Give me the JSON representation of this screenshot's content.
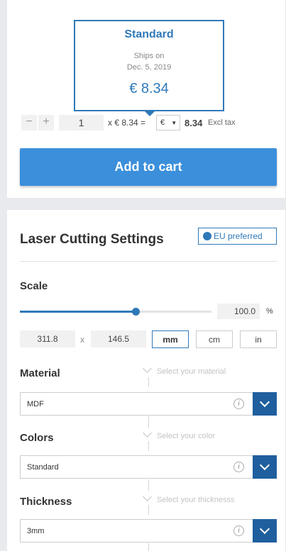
{
  "shipping": {
    "title": "Standard",
    "ships_on_label": "Ships on",
    "ships_date": "Dec. 5, 2019",
    "price": "€ 8.34"
  },
  "quantity": {
    "minus": "−",
    "plus": "+",
    "value": "1",
    "unit_price_text": "x € 8.34 =",
    "currency": "€",
    "total": "8.34",
    "tax_note": "Excl tax"
  },
  "cart": {
    "add_label": "Add to cart"
  },
  "settings": {
    "title": "Laser Cutting Settings",
    "eu_badge": "EU preferred",
    "scale_label": "Scale",
    "scale_value": "100.0",
    "scale_unit": "%",
    "scale_fraction": 0.605,
    "width": "311.8",
    "times": "x",
    "height": "146.5",
    "units": [
      "mm",
      "cm",
      "in"
    ],
    "active_unit": "mm"
  },
  "material": {
    "label": "Material",
    "hint": "Select your material",
    "value": "MDF"
  },
  "colors": {
    "label": "Colors",
    "hint": "Select your color",
    "value": "Standard"
  },
  "thickness": {
    "label": "Thickness",
    "hint": "Select your thicknesss",
    "value": "3mm"
  },
  "icons": {
    "info": "i",
    "globe": "globe-icon",
    "dropdown": "chevron-down-icon"
  },
  "colors_palette": {
    "accent": "#2f79b9",
    "button": "#3b8fdb",
    "dropdown": "#1f5f9e"
  }
}
